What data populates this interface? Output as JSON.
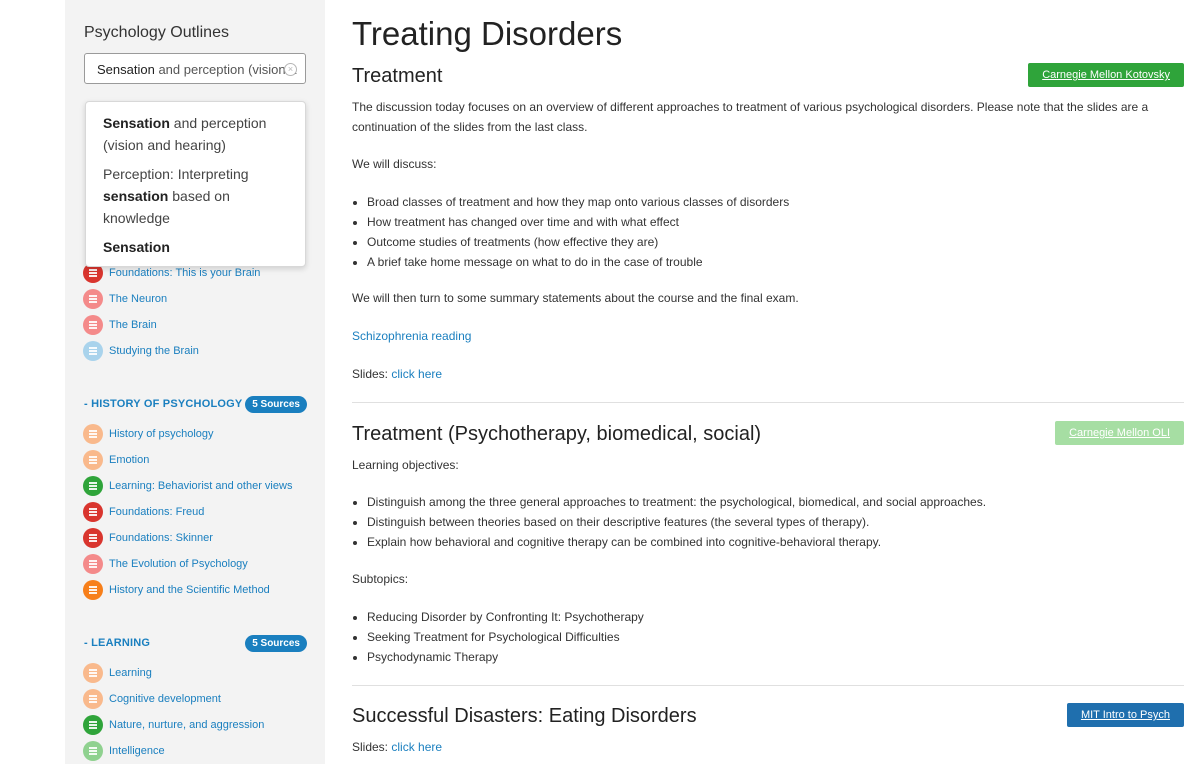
{
  "sidebar": {
    "title": "Psychology Outlines",
    "search": {
      "bold": "Sensation",
      "rest": " and perception (vision a"
    },
    "suggestions": [
      {
        "bold": "Sensation",
        "rest": " and perception (vision and hearing)"
      },
      {
        "pre": "Perception: Interpreting ",
        "bold": "sensation",
        "rest": " based on knowledge"
      },
      {
        "bold": "Sensation"
      }
    ],
    "brain_items": [
      {
        "label": "Foundations: This is your Brain",
        "color": "#d9352e"
      },
      {
        "label": "The Neuron",
        "color": "#f48a8a"
      },
      {
        "label": "The Brain",
        "color": "#f48a8a"
      },
      {
        "label": "Studying the Brain",
        "color": "#a9d3ec"
      }
    ],
    "history": {
      "heading": "- HISTORY OF PSYCHOLOGY",
      "badge": "5 Sources",
      "items": [
        {
          "label": "History of psychology",
          "color": "#f9b98c"
        },
        {
          "label": "Emotion",
          "color": "#f9b98c"
        },
        {
          "label": "Learning: Behaviorist and other views",
          "color": "#2fa43a"
        },
        {
          "label": "Foundations: Freud",
          "color": "#d9352e"
        },
        {
          "label": "Foundations: Skinner",
          "color": "#d9352e"
        },
        {
          "label": "The Evolution of Psychology",
          "color": "#f48a8a"
        },
        {
          "label": "History and the Scientific Method",
          "color": "#f77f1a"
        }
      ]
    },
    "learning": {
      "heading": "- LEARNING",
      "badge": "5 Sources",
      "items": [
        {
          "label": "Learning",
          "color": "#f9b98c"
        },
        {
          "label": "Cognitive development",
          "color": "#f9b98c"
        },
        {
          "label": "Nature, nurture, and aggression",
          "color": "#2fa43a"
        },
        {
          "label": "Intelligence",
          "color": "#8fd18f"
        }
      ]
    }
  },
  "main": {
    "page_title": "Treating Disorders",
    "sections": [
      {
        "title": "Treatment",
        "tag": "Carnegie Mellon Kotovsky",
        "tag_color": "#2fa43a",
        "intro": "The discussion today focuses on an overview of different approaches to treatment of various psychological disorders. Please note that the slides are a continuation of the slides from the last class.",
        "discuss": "We will discuss:",
        "bullets": [
          "Broad classes of treatment and how they map onto various classes of disorders",
          "How treatment has changed over time and with what effect",
          "Outcome studies of treatments (how effective they are)",
          "A brief take home message on what to do in the case of trouble"
        ],
        "then": "We will then turn to some summary statements about the course and the final exam.",
        "reading": "Schizophrenia reading",
        "slides_label": "Slides: ",
        "slides_link": "click here"
      },
      {
        "title": "Treatment (Psychotherapy, biomedical, social)",
        "tag": "Carnegie Mellon OLI",
        "tag_color": "#a6dea3",
        "objectives_label": "Learning objectives:",
        "objectives": [
          "Distinguish among the three general approaches to treatment: the psychological, biomedical, and social approaches.",
          "Distinguish between theories based on their descriptive features (the several types of therapy).",
          "Explain how behavioral and cognitive therapy can be combined into cognitive-behavioral therapy."
        ],
        "subtopics_label": "Subtopics:",
        "subtopics": [
          "Reducing Disorder by Confronting It: Psychotherapy",
          "Seeking Treatment for Psychological Difficulties",
          "Psychodynamic Therapy"
        ]
      },
      {
        "title": "Successful Disasters: Eating Disorders",
        "tag": "MIT Intro to Psych",
        "tag_color": "#1f6fae",
        "slides_label": "Slides: ",
        "slides_link": "click here"
      }
    ]
  }
}
